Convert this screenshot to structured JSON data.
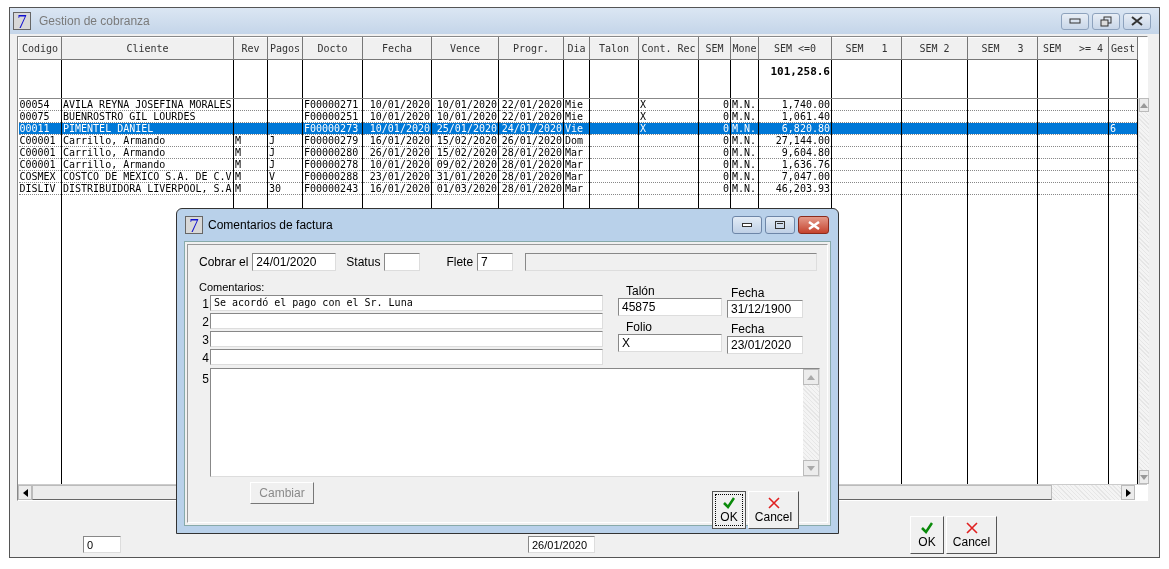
{
  "window": {
    "logo": "7",
    "title": "Gestion de cobranza"
  },
  "table": {
    "columns": [
      "Codigo",
      "Cliente",
      "Rev",
      "Pagos",
      "Docto",
      "Fecha",
      "Vence",
      "Progr.",
      "Dia",
      "Talon",
      "Cont. Rec",
      "SEM",
      "Mone",
      "SEM <=0",
      "SEM   1",
      "SEM 2",
      "SEM   3",
      "SEM   >= 4",
      "Gest"
    ],
    "total": {
      "sem_le0": "101,258.6"
    },
    "rows": [
      {
        "codigo": "00054",
        "cliente": "AVILA REYNA JOSEFINA MORALES",
        "docto": "F00000271",
        "fecha": "10/01/2020",
        "vence": "10/01/2020",
        "progr": "22/01/2020",
        "dia": "Mie",
        "cont_rec": "X",
        "sem": "0",
        "mone": "M.N.",
        "sem_le0": "1,740.00",
        "selected": false
      },
      {
        "codigo": "00075",
        "cliente": "BUENROSTRO GIL LOURDES",
        "docto": "F00000251",
        "fecha": "10/01/2020",
        "vence": "10/01/2020",
        "progr": "22/01/2020",
        "dia": "Mie",
        "cont_rec": "X",
        "sem": "0",
        "mone": "M.N.",
        "sem_le0": "1,061.40",
        "selected": false
      },
      {
        "codigo": "00011",
        "cliente": "PIMENTEL DANIEL",
        "docto": "F00000273",
        "fecha": "10/01/2020",
        "vence": "25/01/2020",
        "progr": "24/01/2020",
        "dia": "Vie",
        "cont_rec": "X",
        "sem": "0",
        "mone": "M.N.",
        "sem_le0": "6,820.80",
        "gest": "6",
        "selected": true
      },
      {
        "codigo": "C00001",
        "cliente": "Carrillo, Armando",
        "rev": "M",
        "pagos": "J",
        "docto": "F00000279",
        "fecha": "16/01/2020",
        "vence": "15/02/2020",
        "progr": "26/01/2020",
        "dia": "Dom",
        "sem": "0",
        "mone": "M.N.",
        "sem_le0": "27,144.00",
        "selected": false
      },
      {
        "codigo": "C00001",
        "cliente": "Carrillo, Armando",
        "rev": "M",
        "pagos": "J",
        "docto": "F00000280",
        "fecha": "26/01/2020",
        "vence": "15/02/2020",
        "progr": "28/01/2020",
        "dia": "Mar",
        "sem": "0",
        "mone": "M.N.",
        "sem_le0": "9,604.80",
        "selected": false
      },
      {
        "codigo": "C00001",
        "cliente": "Carrillo, Armando",
        "rev": "M",
        "pagos": "J",
        "docto": "F00000278",
        "fecha": "10/01/2020",
        "vence": "09/02/2020",
        "progr": "28/01/2020",
        "dia": "Mar",
        "sem": "0",
        "mone": "M.N.",
        "sem_le0": "1,636.76",
        "selected": false
      },
      {
        "codigo": "COSMEX",
        "cliente": "COSTCO DE MEXICO S.A. DE C.V",
        "rev": "M",
        "pagos": "V",
        "docto": "F00000288",
        "fecha": "23/01/2020",
        "vence": "31/01/2020",
        "progr": "28/01/2020",
        "dia": "Mar",
        "sem": "0",
        "mone": "M.N.",
        "sem_le0": "7,047.00",
        "selected": false
      },
      {
        "codigo": "DISLIV",
        "cliente": "DISTRIBUIDORA LIVERPOOL, S.A",
        "rev": "M",
        "pagos": "30",
        "docto": "F00000243",
        "fecha": "16/01/2020",
        "vence": "01/03/2020",
        "progr": "28/01/2020",
        "dia": "Mar",
        "sem": "0",
        "mone": "M.N.",
        "sem_le0": "46,203.93",
        "selected": false
      }
    ]
  },
  "footer": {
    "count_field": "0",
    "date_field": "26/01/2020",
    "buttons": [
      {
        "kind": "ok",
        "label": "OK",
        "focused": false
      },
      {
        "kind": "cancel",
        "label": "Cancel",
        "focused": false
      }
    ]
  },
  "dialog": {
    "logo": "7",
    "title": "Comentarios de factura",
    "cobrar_el": {
      "label": "Cobrar el",
      "value": "24/01/2020"
    },
    "status": {
      "label": "Status"
    },
    "flete": {
      "label": "Flete",
      "value": "7"
    },
    "comentarios_label": "Comentarios:",
    "lines": [
      {
        "number": "1",
        "value": "Se acordó el pago con el Sr. Luna"
      },
      {
        "number": "2"
      },
      {
        "number": "3"
      },
      {
        "number": "4"
      }
    ],
    "memo": {
      "number": "5"
    },
    "talon": {
      "label": "Talón",
      "value": "45875"
    },
    "fecha_1": {
      "label": "Fecha",
      "value": "31/12/1900"
    },
    "folio": {
      "label": "Folio",
      "value": "X"
    },
    "fecha_2": {
      "label": "Fecha",
      "value": "23/01/2020"
    },
    "cambiar": {
      "label": "Cambiar",
      "disabled": true
    },
    "buttons": [
      {
        "kind": "ok",
        "label": "OK",
        "focused": true
      },
      {
        "kind": "cancel",
        "label": "Cancel",
        "focused": false
      }
    ]
  }
}
